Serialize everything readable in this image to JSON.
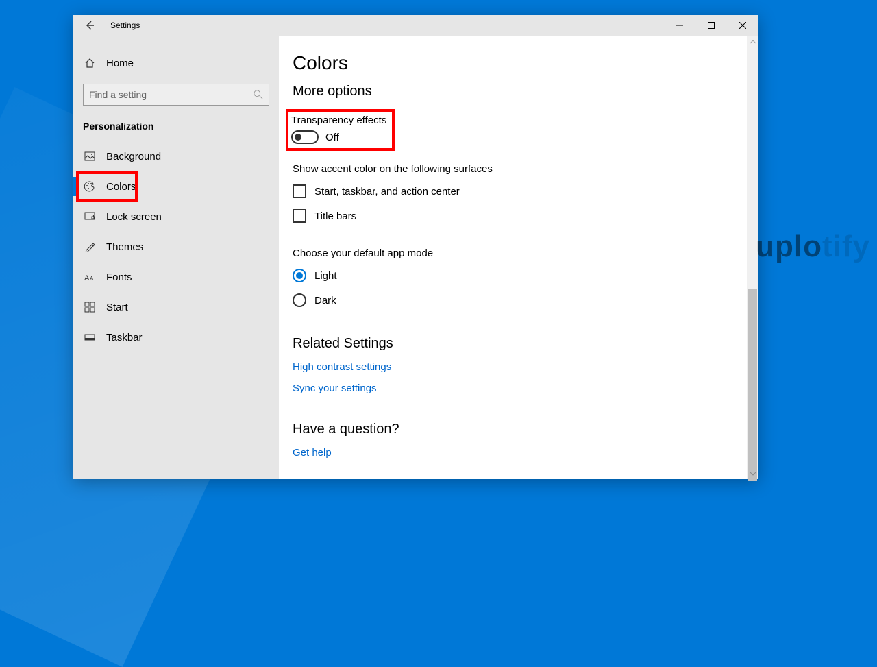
{
  "window": {
    "title": "Settings"
  },
  "sidebar": {
    "home": "Home",
    "search_placeholder": "Find a setting",
    "category": "Personalization",
    "items": [
      {
        "label": "Background"
      },
      {
        "label": "Colors"
      },
      {
        "label": "Lock screen"
      },
      {
        "label": "Themes"
      },
      {
        "label": "Fonts"
      },
      {
        "label": "Start"
      },
      {
        "label": "Taskbar"
      }
    ]
  },
  "content": {
    "page_title": "Colors",
    "more_options_heading": "More options",
    "transparency": {
      "label": "Transparency effects",
      "state": "Off"
    },
    "accent_surfaces_heading": "Show accent color on the following surfaces",
    "checkboxes": [
      {
        "label": "Start, taskbar, and action center"
      },
      {
        "label": "Title bars"
      }
    ],
    "app_mode_heading": "Choose your default app mode",
    "app_modes": [
      {
        "label": "Light",
        "selected": true
      },
      {
        "label": "Dark",
        "selected": false
      }
    ],
    "related_heading": "Related Settings",
    "related_links": [
      "High contrast settings",
      "Sync your settings"
    ],
    "question_heading": "Have a question?",
    "help_link": "Get help"
  },
  "watermark": {
    "dark": "uplo",
    "light": "tify"
  }
}
